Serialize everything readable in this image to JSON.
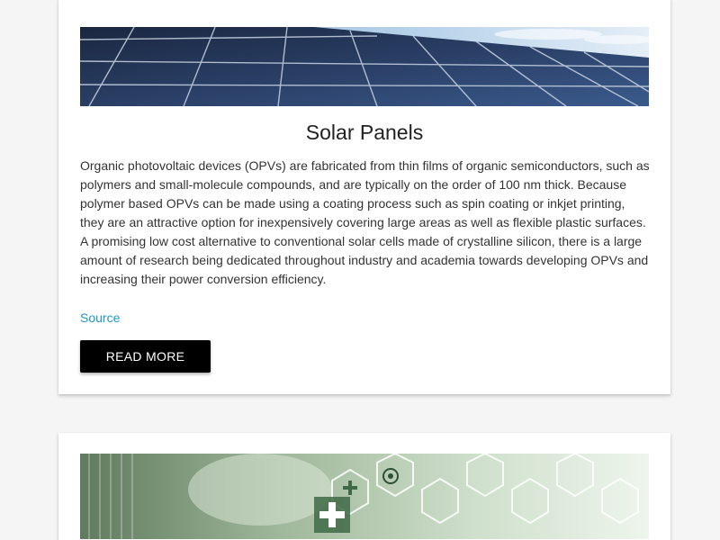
{
  "cards": [
    {
      "banner_icon": "solar-panel-photo",
      "title": "Solar Panels",
      "body": "Organic photovoltaic devices (OPVs) are fabricated from thin films of organic semiconductors, such as polymers and small-molecule compounds, and are typically on the order of 100 nm thick. Because polymer based OPVs can be made using a coating process such as spin coating or inkjet printing, they are an attractive option for inexpensively covering large areas as well as flexible plastic surfaces. A promising low cost alternative to conventional solar cells made of crystalline silicon, there is a large amount of research being dedicated throughout industry and academia towards developing OPVs and increasing their power conversion efficiency.",
      "source_label": "Source",
      "button_label": "READ MORE"
    },
    {
      "banner_icon": "medical-lab-photo"
    }
  ],
  "colors": {
    "link": "#2196c9",
    "button_bg": "#000000",
    "button_text": "#ffffff"
  }
}
